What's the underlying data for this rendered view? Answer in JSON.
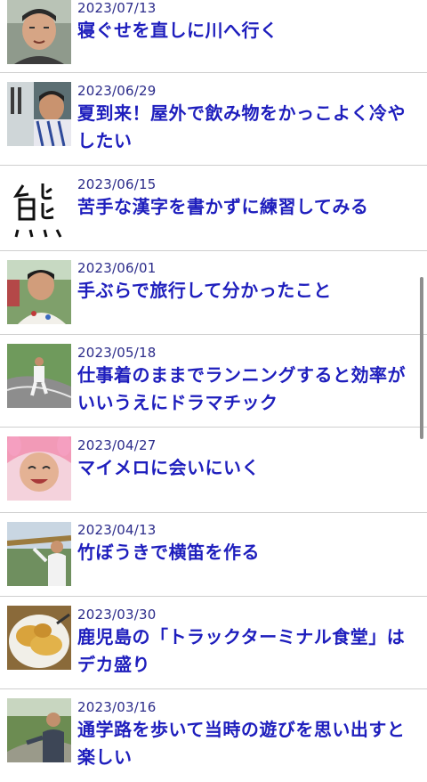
{
  "articles": [
    {
      "date": "2023/07/13",
      "title": "寝ぐせを直しに川へ行く",
      "thumb_icon": "person-portrait"
    },
    {
      "date": "2023/06/29",
      "title": "夏到来！屋外で飲み物をかっこよく冷やしたい",
      "thumb_icon": "person-car-window"
    },
    {
      "date": "2023/06/15",
      "title": "苦手な漢字を書かずに練習してみる",
      "thumb_icon": "kanji-calligraphy"
    },
    {
      "date": "2023/06/01",
      "title": "手ぶらで旅行して分かったこと",
      "thumb_icon": "person-portrait-outdoors"
    },
    {
      "date": "2023/05/18",
      "title": "仕事着のままでランニングすると効率がいいうえにドラマチック",
      "thumb_icon": "person-running-road"
    },
    {
      "date": "2023/04/27",
      "title": "マイメロに会いにいく",
      "thumb_icon": "person-pink-hood"
    },
    {
      "date": "2023/04/13",
      "title": "竹ぼうきで横笛を作る",
      "thumb_icon": "person-bamboo-flute"
    },
    {
      "date": "2023/03/30",
      "title": "鹿児島の「トラックターミナル食堂」はデカ盛り",
      "thumb_icon": "fried-food-plate"
    },
    {
      "date": "2023/03/16",
      "title": "通学路を歩いて当時の遊びを思い出すと楽しい",
      "thumb_icon": "person-walking-path"
    }
  ]
}
